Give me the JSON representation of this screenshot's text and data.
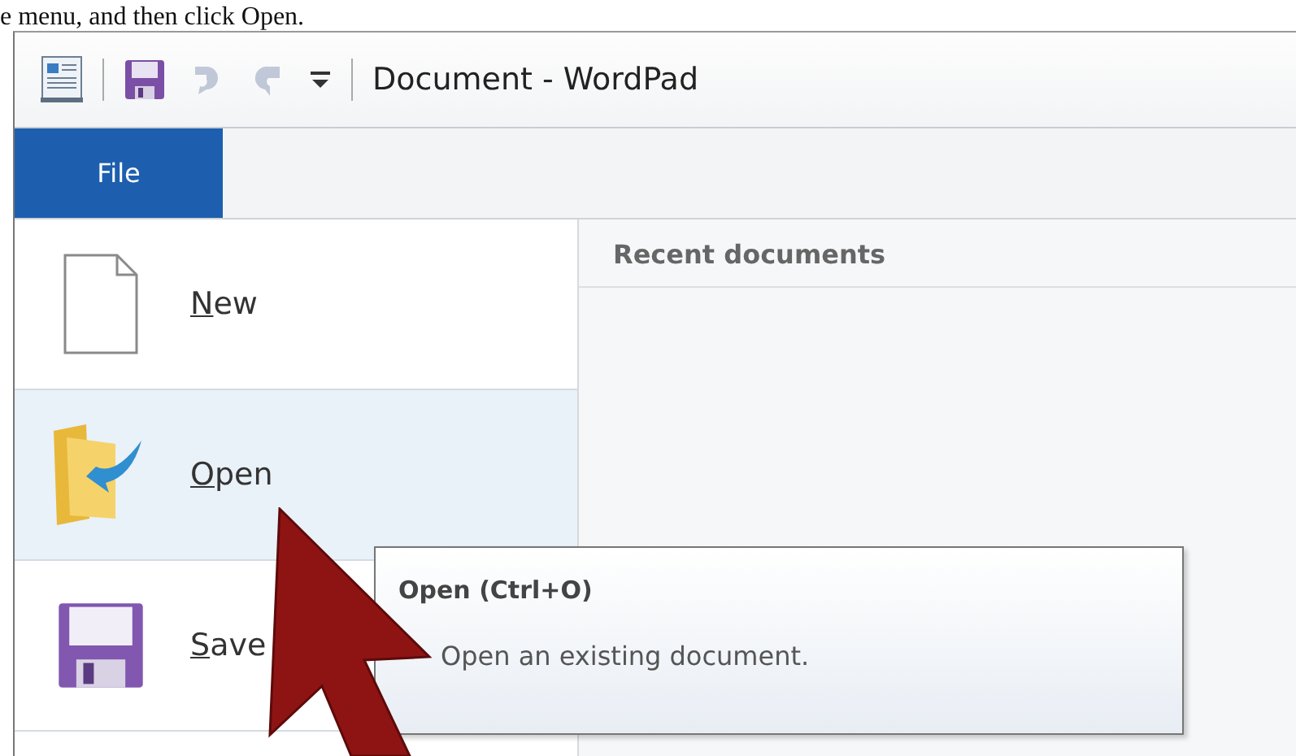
{
  "caption": "e menu, and then click Open.",
  "window": {
    "title": "Document - WordPad"
  },
  "quick_access": [
    {
      "kind": "save",
      "disabled": false
    },
    {
      "kind": "undo",
      "disabled": true
    },
    {
      "kind": "redo",
      "disabled": true
    }
  ],
  "ribbon_tabs": [
    {
      "label": "File",
      "selected": true
    }
  ],
  "file_menu": {
    "items": [
      {
        "kind": "new",
        "label": "New",
        "selected": false
      },
      {
        "kind": "open",
        "label": "Open",
        "selected": true
      },
      {
        "kind": "save",
        "label": "Save",
        "selected": false
      }
    ],
    "recent_header": "Recent documents"
  },
  "tooltip": {
    "title": "Open (Ctrl+O)",
    "description": "Open an existing document."
  }
}
